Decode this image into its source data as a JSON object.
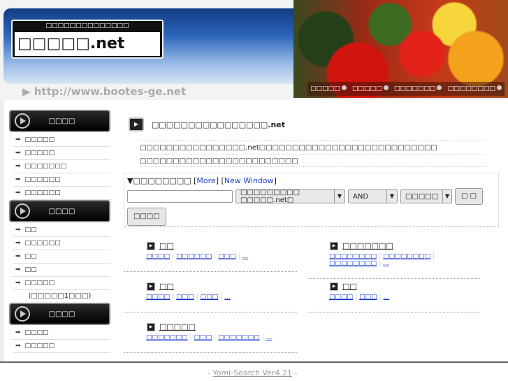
{
  "header": {
    "logo_sub": "□□□□□□□□□□□□□□",
    "logo_main": "□□□□□.net",
    "url": "▶ http://www.bootes-ge.net",
    "nav": [
      "□□□□□",
      "□□□□□",
      "□□□□□□□",
      "□□□□□□□□"
    ]
  },
  "sidebar": {
    "sections": [
      {
        "title": "□□□□",
        "items": [
          "□□□□□",
          "□□□□□",
          "□□□□□□□",
          "□□□□□□",
          "□□□□□□"
        ]
      },
      {
        "title": "□□□□",
        "items": [
          "□□",
          "□□□□□□",
          "□□",
          "□□",
          "□□□□□"
        ],
        "note": "(□□□□□1□□□)"
      },
      {
        "title": "□□□□",
        "items": [
          "□□□□",
          "□□□□□"
        ]
      }
    ]
  },
  "main": {
    "title": "□□□□□□□□□□□□□□□□.net",
    "desc": [
      "□□□□□□□□□□□□□□□□.net□□□□□□□□□□□□□□□□□□□□□□□□□□□",
      "□□□□□□□□□□□□□□□□□□□□□□□□"
    ]
  },
  "search": {
    "label": "▼□□□□□□□□",
    "more": "More",
    "new_window": "New Window",
    "input_value": "",
    "target": "□□□□□□□□□ □□□□□.net□",
    "mode": "AND",
    "range": "□□□□□",
    "submit": "□ □",
    "detail": "□□□□"
  },
  "categories": [
    {
      "title": "□□",
      "links": [
        "□□□□",
        "□□□□□□",
        "□□□",
        "..."
      ]
    },
    {
      "title": "□□□□□□□",
      "links": [
        "□□□□□□□□",
        "□□□□□□□□",
        "□□□□□□□□",
        "..."
      ]
    },
    {
      "title": "□□",
      "links": [
        "□□□□",
        "□□□",
        "□□□",
        "..."
      ]
    },
    {
      "title": "□□",
      "links": [
        "□□□□",
        "□□□",
        "..."
      ]
    },
    {
      "title": "□□□□□",
      "links": [
        "□□□□□□□",
        "□□□",
        "□□□□□□□",
        "..."
      ]
    }
  ],
  "footer": {
    "prefix": "- ",
    "link": "Yomi-Search Ver4.21",
    "suffix": " -"
  }
}
